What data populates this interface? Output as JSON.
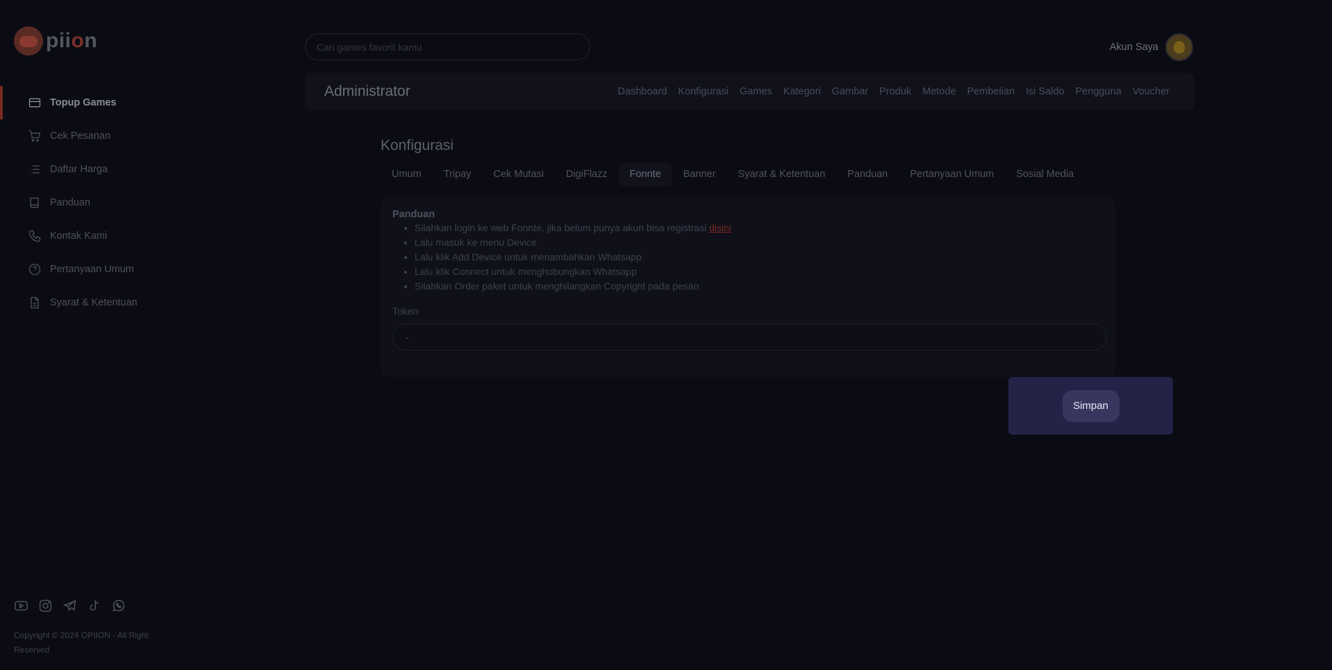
{
  "brand": {
    "logo_text_pre": "pii",
    "logo_text_o": "o",
    "logo_text_post": "n"
  },
  "sidebar": {
    "items": [
      {
        "label": "Topup Games",
        "icon": "credit-card-icon",
        "active": true
      },
      {
        "label": "Cek Pesanan",
        "icon": "cart-icon",
        "active": false
      },
      {
        "label": "Daftar Harga",
        "icon": "list-icon",
        "active": false
      },
      {
        "label": "Panduan",
        "icon": "book-icon",
        "active": false
      },
      {
        "label": "Kontak Kami",
        "icon": "phone-icon",
        "active": false
      },
      {
        "label": "Pertanyaan Umum",
        "icon": "help-circle-icon",
        "active": false
      },
      {
        "label": "Syarat & Ketentuan",
        "icon": "document-icon",
        "active": false
      }
    ],
    "socials": [
      "youtube-icon",
      "instagram-icon",
      "telegram-icon",
      "tiktok-icon",
      "whatsapp-icon"
    ],
    "copyright": "Copyright © 2024 OPIION - All Right Reserved"
  },
  "header": {
    "search_placeholder": "Cari games favorit kamu",
    "account_label": "Akun Saya"
  },
  "admin": {
    "title": "Administrator",
    "links": [
      "Dashboard",
      "Konfigurasi",
      "Games",
      "Kategori",
      "Gambar",
      "Produk",
      "Metode",
      "Pembelian",
      "Isi Saldo",
      "Pengguna",
      "Voucher"
    ]
  },
  "config": {
    "title": "Konfigurasi",
    "tabs": [
      "Umum",
      "Tripay",
      "Cek Mutasi",
      "DigiFlazz",
      "Fonnte",
      "Banner",
      "Syarat & Ketentuan",
      "Panduan",
      "Pertanyaan Umum",
      "Sosial Media"
    ],
    "active_tab": "Fonnte",
    "guide_title": "Panduan",
    "guide_first_text": "Silahkan login ke web Fonnte, jika belum punya akun bisa registrasi ",
    "guide_first_link": "disini",
    "guide_items": [
      "Lalu masuk ke menu Device",
      "Lalu klik Add Device untuk menambahkan Whatsapp",
      "Lalu klik Connect untuk menghubungkan Whatsapp",
      "Silahkan Order paket untuk menghilangkan Copyright pada pesan"
    ],
    "token_label": "Token",
    "token_value": "-",
    "save_label": "Simpan"
  },
  "colors": {
    "background": "#0b0b14",
    "accent": "#7a2a22",
    "save_panel": "#242347"
  }
}
